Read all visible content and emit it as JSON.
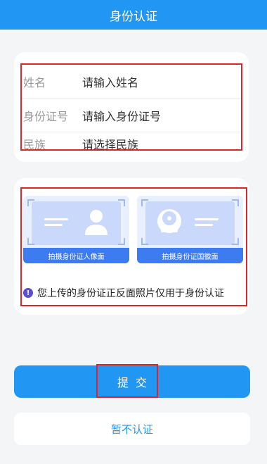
{
  "header": {
    "title": "身份认证"
  },
  "form": {
    "name": {
      "label": "姓名",
      "placeholder": "请输入姓名"
    },
    "id_number": {
      "label": "身份证号",
      "placeholder": "请输入身份证号"
    },
    "ethnicity": {
      "label": "民族",
      "placeholder": "请选择民族"
    }
  },
  "upload": {
    "front_caption": "拍摄身份证人像面",
    "back_caption": "拍摄身份证国徽面",
    "notice": "您上传的身份证正反面照片仅用于身份认证"
  },
  "actions": {
    "submit_label": "提交",
    "skip_label": "暂不认证"
  },
  "colors": {
    "primary": "#2196f3",
    "highlight": "#e0242a",
    "card_blue": "#3d7bf0"
  }
}
